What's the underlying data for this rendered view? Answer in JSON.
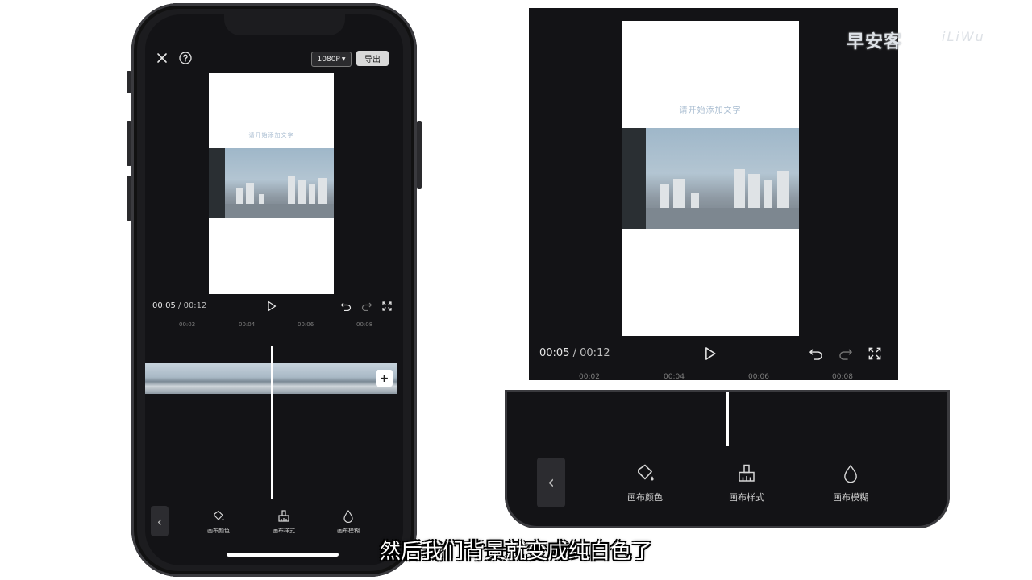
{
  "editor": {
    "resolution_label": "1080P",
    "export_label": "导出",
    "canvas_caption": "请开始添加文字",
    "current_time": "00:05",
    "time_separator": "/",
    "total_time": "00:12",
    "ruler_ticks": [
      "00:02",
      "00:04",
      "00:06",
      "00:08"
    ],
    "add_clip_symbol": "+",
    "tools": [
      {
        "icon": "paint-bucket-icon",
        "label": "画布颜色"
      },
      {
        "icon": "brush-icon",
        "label": "画布样式"
      },
      {
        "icon": "drop-icon",
        "label": "画布模糊"
      }
    ],
    "back_symbol": "‹"
  },
  "zoom": {
    "current_time": "00:05",
    "time_separator": "/",
    "total_time": "00:12",
    "ruler_ticks": [
      "00:02",
      "00:04",
      "00:06",
      "00:08"
    ]
  },
  "watermark": {
    "text": "早安客",
    "suffix": "iLiWu"
  },
  "subtitle": "然后我们背景就变成纯白色了",
  "colors": {
    "background": "#131316",
    "accent": "#ffffff",
    "sky": "#9fb7c9"
  }
}
